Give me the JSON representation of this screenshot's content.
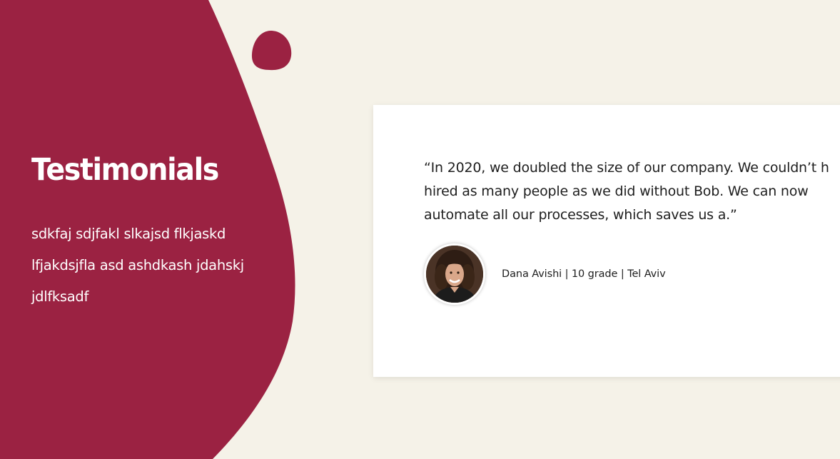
{
  "section": {
    "title": "Testimonials",
    "description_lines": [
      "sdkfaj sdjfakl slkajsd flkjaskd",
      "lfjakdsjfla asd ashdkash jdahskj",
      "jdlfksadf"
    ]
  },
  "testimonial": {
    "quote_lines": [
      "“In 2020, we doubled the size of our company. We couldn’t h",
      "hired as many people as we did without Bob. We can now",
      "automate all our processes, which saves us a.”"
    ],
    "author": {
      "name": "Dana Avishi",
      "grade": "10 grade",
      "city": "Tel Aviv",
      "separator": " | "
    },
    "avatar_icon": "person-photo-icon"
  },
  "colors": {
    "background": "#f5f2e8",
    "blob": "#9b2242",
    "card": "#ffffff",
    "text": "#1e1e1e"
  }
}
